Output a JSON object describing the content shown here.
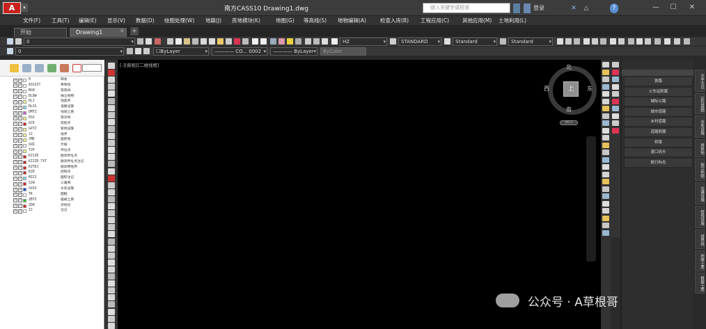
{
  "app": {
    "title": "南方CASS10    Drawing1.dwg",
    "logo": "A",
    "quick_access": "▾",
    "search_placeholder": "键入关键字或短语",
    "login": "登录",
    "win_buttons": [
      "—",
      "☐",
      "✕"
    ]
  },
  "menu": [
    "文件(F)",
    "工具(T)",
    "编辑(E)",
    "显示(V)",
    "数据(D)",
    "绘图处理(W)",
    "地籍(J)",
    "房地横块(K)",
    "地图(G)",
    "等高线(S)",
    "地物编辑(A)",
    "检查入库(B)",
    "工程应用(C)",
    "其他应用(M)",
    "土地利用(L)"
  ],
  "tabs": [
    {
      "label": "开始"
    },
    {
      "label": "Drawing1"
    }
  ],
  "toolbar1": {
    "layer": "0",
    "text_style": "HZ",
    "dim_style": "STANDARD",
    "table_style": "Standard",
    "mleader_style": "Standard"
  },
  "toolbar2": {
    "layer": "0",
    "color": "☐ByLayer",
    "linetype": "———— CO... 0002",
    "lineweight": "———— ByLayer",
    "plotstyle": "ByColor"
  },
  "layer_panel": {
    "layers": [
      {
        "name": "0",
        "desc": "缺省",
        "color": "#ffffff"
      },
      {
        "name": "ASSIST",
        "desc": "骨架线",
        "color": "#ffffff"
      },
      {
        "name": "BGH",
        "desc": "等高线",
        "color": "#ffffff"
      },
      {
        "name": "DLDW",
        "desc": "独立地物",
        "color": "#ffffff"
      },
      {
        "name": "DLJ",
        "desc": "地类界",
        "color": "#f5f58a"
      },
      {
        "name": "DLSS",
        "desc": "道路设施",
        "color": "#7ad8f0"
      },
      {
        "name": "DMTZ",
        "desc": "地貌土质",
        "color": "#d05fd0"
      },
      {
        "name": "DSX",
        "desc": "等深线",
        "color": "#f5f58a"
      },
      {
        "name": "GCD",
        "desc": "高程点",
        "color": "#d62020"
      },
      {
        "name": "GXYZ",
        "desc": "管线设施",
        "color": "#f5f58a"
      },
      {
        "name": "JJ",
        "desc": "境界",
        "color": "#f5f58a"
      },
      {
        "name": "JMD",
        "desc": "居民地",
        "color": "#f5f58a"
      },
      {
        "name": "SXD",
        "desc": "示坡",
        "color": "#ffffff"
      },
      {
        "name": "TJP",
        "desc": "界址点",
        "color": "#f5f58a"
      },
      {
        "name": "KZJZD",
        "desc": "勘测界址点",
        "color": "#d62020"
      },
      {
        "name": "KZJZD_TXT",
        "desc": "勘测界址点注记",
        "color": "#d62020"
      },
      {
        "name": "KZYDJ",
        "desc": "勘测用地界",
        "color": "#d62020"
      },
      {
        "name": "KZD",
        "desc": "控制点",
        "color": "#d62020"
      },
      {
        "name": "MJZJ",
        "desc": "面积注记",
        "color": "#7ad8f0"
      },
      {
        "name": "SJW",
        "desc": "三角网",
        "color": "#d62020"
      },
      {
        "name": "SXSS",
        "desc": "水系设施",
        "color": "#2050d8"
      },
      {
        "name": "TK",
        "desc": "图框",
        "color": "#ffffff"
      },
      {
        "name": "ZBTZ",
        "desc": "植被土质",
        "color": "#2ebf2e"
      },
      {
        "name": "ZDH",
        "desc": "宗地号",
        "color": "#d62020"
      },
      {
        "name": "ZJ",
        "desc": "注记",
        "color": "#ffffff"
      }
    ]
  },
  "canvas": {
    "viewport_label": "[-][俯视][二维线框]",
    "compass": {
      "n": "北",
      "s": "南",
      "e": "东",
      "w": "西",
      "cube": "上"
    },
    "wcs": "WCS"
  },
  "legend_panel": {
    "buttons": [
      "铁路",
      "火车站附属",
      "城际公路",
      "城市道路",
      "乡村道路",
      "道路附属",
      "桥梁",
      "渡口码头",
      "航行标志"
    ]
  },
  "side_tabs": [
    "文字注记",
    "定位基础",
    "水系设施",
    "居民地",
    "独立地物",
    "交通设施",
    "管线设施",
    "境界线",
    "地貌土质",
    "植被土质"
  ],
  "watermark": {
    "text": "公众号 · A草根哥"
  },
  "colors": {
    "canvas": "#000000",
    "accent": "#c8221d"
  }
}
